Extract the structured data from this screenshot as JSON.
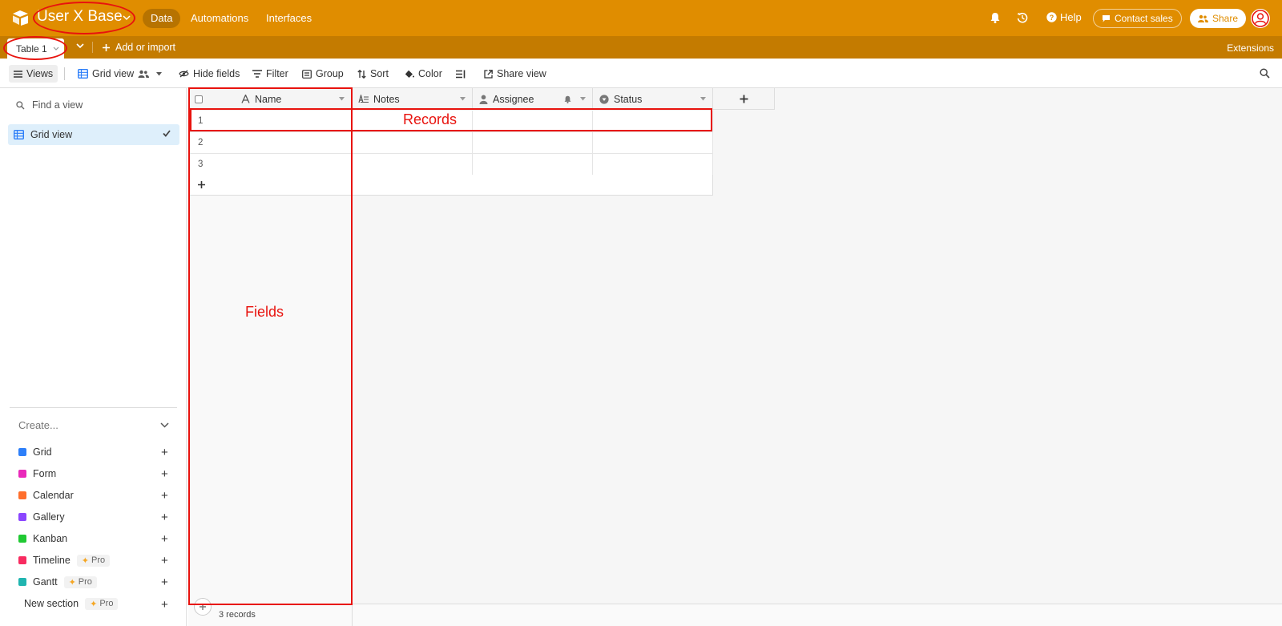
{
  "app": {
    "base_title": "User X Base",
    "nav_tabs": [
      "Data",
      "Automations",
      "Interfaces"
    ],
    "active_tab": "Data",
    "help_label": "Help",
    "contact_sales_label": "Contact sales",
    "share_label": "Share",
    "brand_color": "#e08d00"
  },
  "tablebar": {
    "active_table": "Table 1",
    "add_import_label": "Add or import",
    "extensions_label": "Extensions"
  },
  "viewbar": {
    "views_label": "Views",
    "grid_view_label": "Grid view",
    "hide_fields_label": "Hide fields",
    "filter_label": "Filter",
    "group_label": "Group",
    "sort_label": "Sort",
    "color_label": "Color",
    "share_view_label": "Share view"
  },
  "sidebar": {
    "find_placeholder": "Find a view",
    "views": [
      {
        "label": "Grid view",
        "icon": "grid-view-icon",
        "selected": true
      }
    ],
    "create_label": "Create...",
    "create_items": [
      {
        "label": "Grid",
        "color": "#2d7ff9",
        "pro": false
      },
      {
        "label": "Form",
        "color": "#e929ba",
        "pro": false
      },
      {
        "label": "Calendar",
        "color": "#ff6f2c",
        "pro": false
      },
      {
        "label": "Gallery",
        "color": "#8b46ff",
        "pro": false
      },
      {
        "label": "Kanban",
        "color": "#20c933",
        "pro": false
      },
      {
        "label": "Timeline",
        "color": "#f82b60",
        "pro": true
      },
      {
        "label": "Gantt",
        "color": "#20d9d2",
        "pro": true
      },
      {
        "label": "New section",
        "color": "",
        "pro": true
      }
    ],
    "pro_label": "Pro"
  },
  "grid": {
    "columns": [
      {
        "label": "Name",
        "icon": "text-icon"
      },
      {
        "label": "Notes",
        "icon": "long-text-icon"
      },
      {
        "label": "Assignee",
        "icon": "user-icon"
      },
      {
        "label": "Status",
        "icon": "status-icon"
      }
    ],
    "rows": [
      "1",
      "2",
      "3"
    ],
    "record_count": "3 records"
  },
  "annotations": {
    "records_label": "Records",
    "fields_label": "Fields",
    "color": "#e8130e"
  }
}
